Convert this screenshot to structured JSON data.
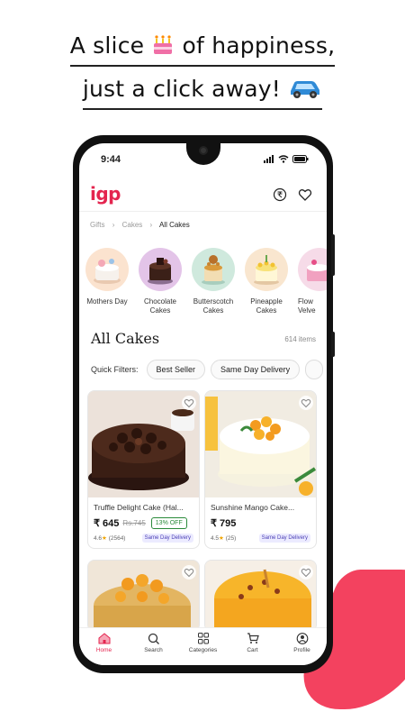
{
  "promo": {
    "line1_before": "A slice",
    "line1_after": "of happiness,",
    "line2": "just a click away!",
    "cake_emoji_icon": "birthday-cake",
    "car_emoji_icon": "car"
  },
  "status_bar": {
    "time": "9:44"
  },
  "app": {
    "logo": "igp",
    "brand_color": "#e4254f"
  },
  "breadcrumb": {
    "items": [
      "Gifts",
      "Cakes",
      "All Cakes"
    ]
  },
  "categories": [
    {
      "line1": "Mothers Day",
      "line2": ""
    },
    {
      "line1": "Chocolate",
      "line2": "Cakes"
    },
    {
      "line1": "Butterscotch",
      "line2": "Cakes"
    },
    {
      "line1": "Pineapple",
      "line2": "Cakes"
    },
    {
      "line1": "Flow",
      "line2": "Velve"
    }
  ],
  "listing": {
    "title": "All Cakes",
    "count": "614 items"
  },
  "filters": {
    "label": "Quick Filters:",
    "chips": [
      "Best Seller",
      "Same Day Delivery"
    ]
  },
  "products": [
    {
      "name": "Truffle Delight Cake (Hal...",
      "price": "₹ 645",
      "mrp": "Rs.745",
      "discount": "13% OFF",
      "rating": "4.6",
      "reviews": "(2564)",
      "badge": "Same Day Delivery"
    },
    {
      "name": "Sunshine Mango Cake...",
      "price": "₹ 795",
      "mrp": "",
      "discount": "",
      "rating": "4.5",
      "reviews": "(25)",
      "badge": "Same Day Delivery"
    }
  ],
  "bottom_nav": [
    "Home",
    "Search",
    "Categories",
    "Cart",
    "Profile"
  ]
}
